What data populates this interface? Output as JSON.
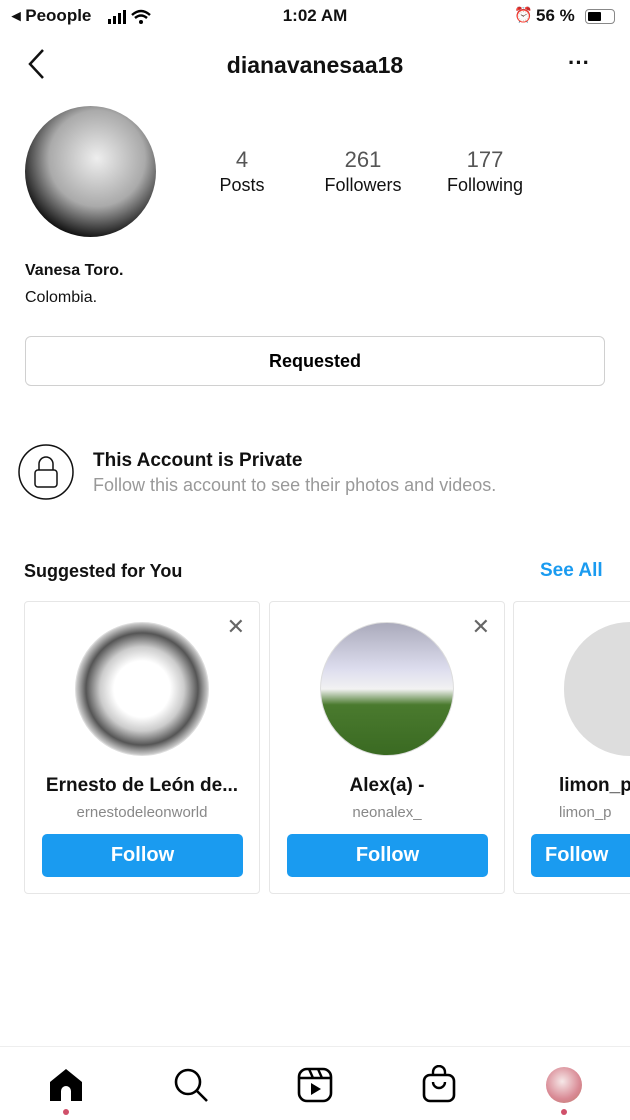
{
  "status_bar": {
    "carrier": "◂ Peoople",
    "time": "1:02 AM",
    "battery": "56 %"
  },
  "header": {
    "title": "dianavanesaa18"
  },
  "profile": {
    "stats": [
      {
        "value": "4",
        "label": "Posts"
      },
      {
        "value": "261",
        "label": "Followers"
      },
      {
        "value": "177",
        "label": "Following"
      }
    ],
    "name": "Vanesa Toro.",
    "bio": "Colombia.",
    "requested_label": "Requested"
  },
  "private": {
    "title": "This Account is Private",
    "subtitle": "Follow this account to see their photos and videos."
  },
  "suggested": {
    "title": "Suggested for You",
    "see_all": "See All",
    "cards": [
      {
        "name": "Ernesto de León de...",
        "username": "ernestodeleonworld",
        "follow": "Follow"
      },
      {
        "name": "Alex(a) -",
        "username": "neonalex_",
        "follow": "Follow"
      },
      {
        "name": "limon_p",
        "username": "limon_p",
        "follow": "Follow"
      }
    ]
  },
  "colors": {
    "accent": "#1a9bf0",
    "notification": "#d0506a"
  },
  "nav": [
    "home-icon",
    "search-icon",
    "reels-icon",
    "shop-icon",
    "profile-avatar"
  ]
}
